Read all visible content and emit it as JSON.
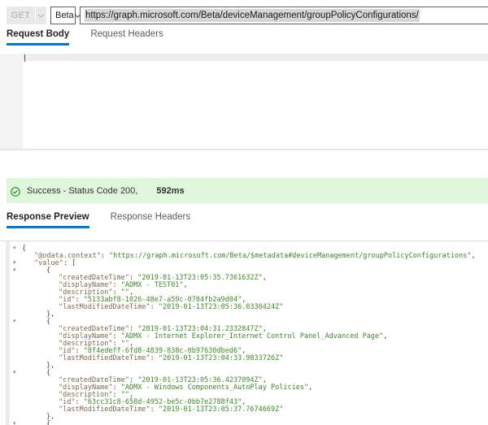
{
  "request_bar": {
    "method": "GET",
    "version": "Beta",
    "url": "https://graph.microsoft.com/Beta/deviceManagement/groupPolicyConfigurations/"
  },
  "tabs": {
    "request_body": "Request Body",
    "request_headers": "Request Headers",
    "response_preview": "Response Preview",
    "response_headers": "Response Headers"
  },
  "status_bar": {
    "icon": "success-check-circle",
    "message": "Success - Status Code 200,",
    "duration": "592ms"
  },
  "response": {
    "odata_context": "https://graph.microsoft.com/Beta/$metadata#deviceManagement/groupPolicyConfigurations",
    "items": [
      {
        "createdDateTime": "2019-01-13T23:05:35.7361632Z",
        "displayName": "ADMX - TEST01",
        "description": "",
        "id": "5133abf8-1026-48e7-a59c-0704fb2a9d04",
        "lastModifiedDateTime": "2019-01-13T23:05:36.0330424Z"
      },
      {
        "createdDateTime": "2019-01-13T23:04:31.2332847Z",
        "displayName": "ADMX - Internet Explorer_Internet Control Panel_Advanced Page",
        "description": "",
        "id": "8f4edeff-6fd8-4839-838c-0b97630dbed6",
        "lastModifiedDateTime": "2019-01-13T23:04:33.9833726Z"
      },
      {
        "createdDateTime": "2019-01-13T23:05:36.4237094Z",
        "displayName": "ADMX - Windows Components_AutoPlay Policies",
        "description": "",
        "id": "63cc31c8-658d-4952-be5c-0bb7e2788f43",
        "lastModifiedDateTime": "2019-01-13T23:05:37.7674669Z"
      }
    ],
    "trailing_partial": "{"
  },
  "colors": {
    "accent": "#0078d7",
    "success_bg": "#dff6dd",
    "success_icon": "#107c10",
    "json_key": "#796a4d",
    "json_string": "#3e8726"
  }
}
